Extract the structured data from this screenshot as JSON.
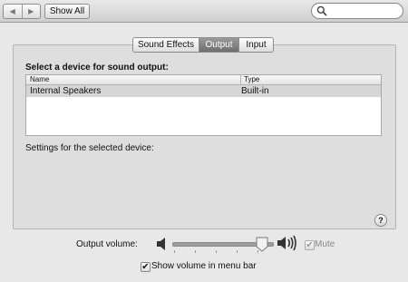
{
  "toolbar": {
    "nav_back_icon": "chevron-left-icon",
    "nav_forward_icon": "chevron-right-icon",
    "nav_back_glyph": "◀",
    "nav_forward_glyph": "▶",
    "show_all_label": "Show All",
    "search_icon": "magnifier-icon",
    "search_value": ""
  },
  "tabs": [
    {
      "label": "Sound Effects",
      "selected": false
    },
    {
      "label": "Output",
      "selected": true
    },
    {
      "label": "Input",
      "selected": false
    }
  ],
  "output": {
    "select_label": "Select a device for sound output:",
    "columns": [
      "Name",
      "Type"
    ],
    "devices": [
      {
        "name": "Internal Speakers",
        "type": "Built-in",
        "selected": true
      }
    ],
    "settings_label": "Settings for the selected device:",
    "help_glyph": "?"
  },
  "volume": {
    "label": "Output volume:",
    "level_fraction": 0.9,
    "mute_label": "Mute",
    "mute_checked": true,
    "mute_enabled": false,
    "show_in_menu_label": "Show volume in menu bar",
    "show_in_menu_checked": true,
    "check_glyph": "✔"
  },
  "colors": {
    "selected_tab": "#7b7b7b",
    "selected_row": "#d6d6d6",
    "window_bg": "#e8e8e8"
  }
}
